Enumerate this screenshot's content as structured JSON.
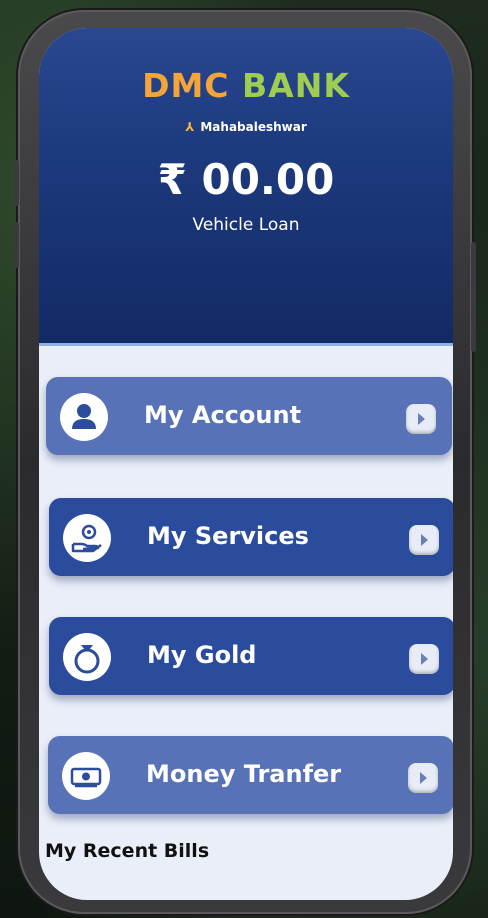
{
  "app": {
    "bank_name_part1": "DMC",
    "bank_name_part2": "BANK",
    "branch": "Mahabaleshwar",
    "balance": "₹ 00.00",
    "account_type": "Vehicle Loan"
  },
  "menu": [
    {
      "label": "My Account",
      "icon": "user-icon",
      "color": "#5872b8"
    },
    {
      "label": "My Services",
      "icon": "hand-coin-icon",
      "color": "#2b4c9c"
    },
    {
      "label": "My Gold",
      "icon": "ring-icon",
      "color": "#2b4c9c"
    },
    {
      "label": "Money Tranfer",
      "icon": "money-icon",
      "color": "#5872b8"
    }
  ],
  "section": {
    "recent_bills_title": "My Recent Bills"
  },
  "colors": {
    "header_top": "#2a4790",
    "header_bottom": "#122a66",
    "screen_bg": "#e9eef8"
  }
}
